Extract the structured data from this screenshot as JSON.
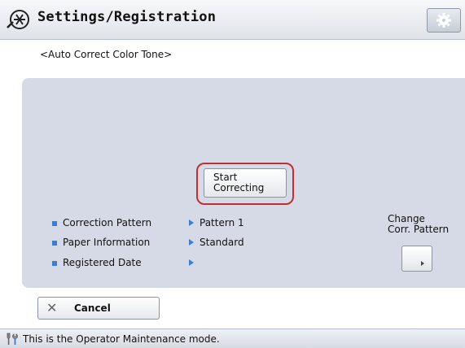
{
  "header": {
    "title": "Settings/Registration",
    "app_icon": "settings-wrench-icon",
    "settings_button_icon": "gear-icon"
  },
  "subtitle": "<Auto Correct Color Tone>",
  "start_button": {
    "label": "Start\nCorrecting"
  },
  "info": [
    {
      "label": "Correction Pattern",
      "value": "Pattern 1"
    },
    {
      "label": "Paper Information",
      "value": "Standard"
    },
    {
      "label": "Registered Date",
      "value": ""
    }
  ],
  "change_pattern": {
    "label": "Change\nCorr. Pattern"
  },
  "cancel": {
    "label": "Cancel",
    "icon": "close-icon"
  },
  "status": {
    "message": "This is the Operator Maintenance mode.",
    "icon": "tools-icon"
  },
  "colors": {
    "accent": "#3a7fd0",
    "highlight": "#c03032",
    "panel": "#d6dae6"
  }
}
